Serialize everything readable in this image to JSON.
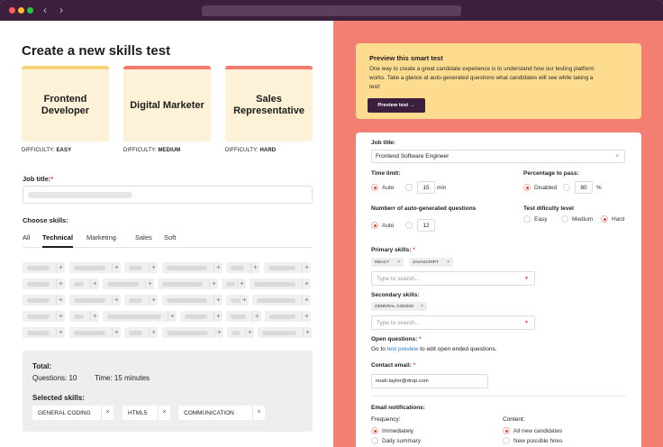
{
  "left": {
    "title": "Create a new skills test",
    "cards": [
      {
        "title": "Frontend Developer",
        "difficulty_label": "DIFFICULTY:",
        "difficulty": "EASY"
      },
      {
        "title": "Digital Marketer",
        "difficulty_label": "DIFFICULTY:",
        "difficulty": "MEDIUM"
      },
      {
        "title": "Sales Representative",
        "difficulty_label": "DIFFICULTY:",
        "difficulty": "HARD"
      }
    ],
    "job_title_label": "Job title:",
    "required_mark": "*",
    "choose_skills_label": "Choose skills:",
    "tabs": [
      "All",
      "Technical",
      "Marketing",
      "Sales",
      "Soft"
    ],
    "active_tab": "Technical",
    "chip_plus": "+",
    "summary": {
      "total_label": "Total:",
      "questions": "Questions: 10",
      "time": "Time: 15 minutes",
      "selected_label": "Selected skills:",
      "selected": [
        "GENERAL CODING",
        "HTML5",
        "COMMUNICATION"
      ],
      "remove": "×"
    }
  },
  "right": {
    "preview": {
      "title": "Preview this smart test",
      "text": "One way to create a great candidate experience is to understand how our testing platform works. Take a glance at auto-generated questions what candidates will see while taking a test!",
      "button": "Preview test →"
    },
    "form": {
      "job_title_label": "Job title:",
      "job_title_value": "Frontend Software Engineer",
      "clear": "×",
      "time_limit_label": "Time limit:",
      "time_auto": "Auto",
      "time_value": "15",
      "time_unit": "min",
      "pass_label": "Percentage to pass:",
      "pass_disabled": "Disabled",
      "pass_value": "80",
      "pass_unit": "%",
      "auto_q_label": "Numberr of auto-generated questions",
      "auto_q_auto": "Auto",
      "auto_q_value": "12",
      "difficulty_label": "Test dificulty level",
      "difficulty_options": [
        "Easy",
        "Medium",
        "Hard"
      ],
      "difficulty_selected": "Hard",
      "primary_label": "Primary skills:",
      "primary_tags": [
        "REACT",
        "JAVASCRIPT"
      ],
      "tag_remove": "×",
      "search_placeholder": "Type to search...",
      "dropdown_arrow": "▼",
      "secondary_label": "Secondary skills:",
      "secondary_tags": [
        "GENERAL CODING"
      ],
      "open_q_label": "Open questions:",
      "open_q_prefix": "Go to",
      "open_q_link": "test preview",
      "open_q_suffix": "to edit open ended questions.",
      "contact_label": "Contact email:",
      "contact_value": "noah.taylor@drop.com",
      "notif_label": "Email notifications:",
      "frequency_label": "Frequency:",
      "frequency_options": [
        "Immediately",
        "Daily summary"
      ],
      "content_label": "Content:",
      "content_options": [
        "All new candidates",
        "New possible hires"
      ]
    }
  },
  "colors": {
    "accent": "#e0463a",
    "brand_dark": "#3b1f3d",
    "right_bg": "#f37f73",
    "preview_bg": "#fddc90"
  }
}
